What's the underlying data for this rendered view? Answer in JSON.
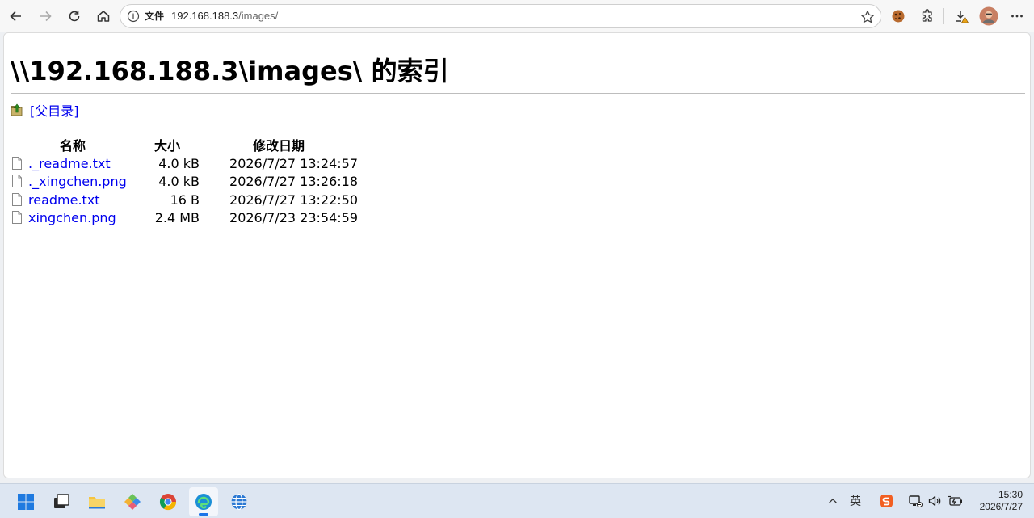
{
  "browser": {
    "address_file_label": "文件",
    "url_host": "192.168.188.3",
    "url_path": "/images/"
  },
  "page": {
    "title": "\\\\192.168.188.3\\images\\ 的索引",
    "parent_link": "[父目录]",
    "columns": {
      "name": "名称",
      "size": "大小",
      "modified": "修改日期"
    },
    "files": [
      {
        "name": "._readme.txt",
        "size": "4.0 kB",
        "modified": "2026/7/27 13:24:57"
      },
      {
        "name": "._xingchen.png",
        "size": "4.0 kB",
        "modified": "2026/7/27 13:26:18"
      },
      {
        "name": "readme.txt",
        "size": "16 B",
        "modified": "2026/7/27 13:22:50"
      },
      {
        "name": "xingchen.png",
        "size": "2.4 MB",
        "modified": "2026/7/23 23:54:59"
      }
    ]
  },
  "taskbar": {
    "time": "15:30",
    "date": "2026/7/27",
    "ime_label": "英"
  },
  "colors": {
    "link": "#0000ee",
    "accent": "#1a73e8",
    "taskbar_bg": "#dde6f2"
  }
}
